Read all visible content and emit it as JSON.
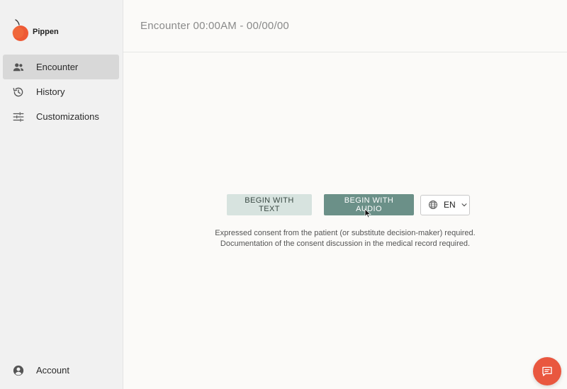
{
  "brand": {
    "name": "Pippen",
    "accent": "#e9573f"
  },
  "sidebar": {
    "items": [
      {
        "label": "Encounter",
        "icon": "people-icon",
        "active": true
      },
      {
        "label": "History",
        "icon": "history-icon",
        "active": false
      },
      {
        "label": "Customizations",
        "icon": "sliders-icon",
        "active": false
      }
    ],
    "account": {
      "label": "Account",
      "icon": "account-circle-icon"
    }
  },
  "header": {
    "title": "Encounter 00:00AM - 00/00/00"
  },
  "actions": {
    "begin_text_label": "BEGIN WITH TEXT",
    "begin_audio_label": "BEGIN WITH AUDIO",
    "language": {
      "value": "EN",
      "icon": "globe-icon"
    }
  },
  "consent": {
    "line1": "Expressed consent from the patient (or substitute decision-maker) required.",
    "line2": "Documentation of the consent discussion in the medical record required."
  },
  "chat": {
    "icon": "chat-icon"
  },
  "colors": {
    "primary": "#6b9088",
    "secondary": "#d7e3df",
    "sidebar_bg": "#f1f1f1",
    "active_bg": "#d8d8d8",
    "fab": "#e9573f"
  }
}
